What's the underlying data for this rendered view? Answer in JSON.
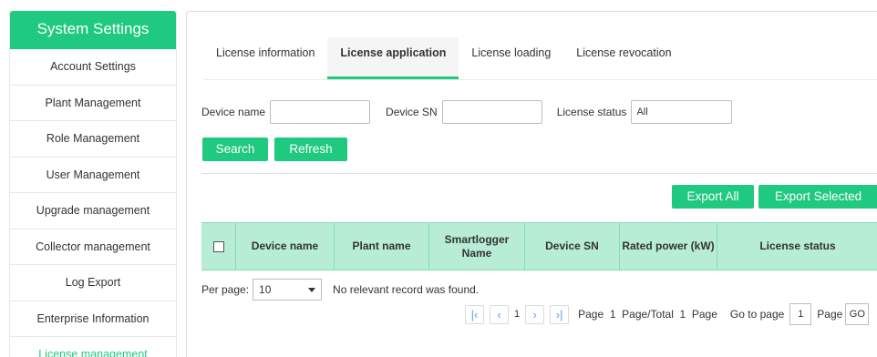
{
  "sidebar": {
    "title": "System Settings",
    "items": [
      {
        "label": "Account Settings"
      },
      {
        "label": "Plant Management"
      },
      {
        "label": "Role Management"
      },
      {
        "label": "User Management"
      },
      {
        "label": "Upgrade management"
      },
      {
        "label": "Collector management"
      },
      {
        "label": "Log Export"
      },
      {
        "label": "Enterprise Information"
      },
      {
        "label": "License management"
      }
    ]
  },
  "tabs": [
    {
      "label": "License information"
    },
    {
      "label": "License application"
    },
    {
      "label": "License loading"
    },
    {
      "label": "License revocation"
    }
  ],
  "filters": {
    "device_name_label": "Device name",
    "device_name_value": "",
    "device_sn_label": "Device SN",
    "device_sn_value": "",
    "license_status_label": "License status",
    "license_status_value": "All"
  },
  "buttons": {
    "search": "Search",
    "refresh": "Refresh",
    "export_all": "Export All",
    "export_selected": "Export Selected"
  },
  "table": {
    "columns": [
      "Device name",
      "Plant name",
      "Smartlogger Name",
      "Device SN",
      "Rated power (kW)",
      "License status"
    ]
  },
  "pagination": {
    "per_page_label": "Per page:",
    "per_page_value": "10",
    "empty_message": "No relevant record was found.",
    "current_page": "1",
    "page_info": "Page  1  Page/Total  1  Page",
    "goto_label": "Go to page",
    "goto_value": "1",
    "page_suffix": "Page",
    "go_button": "GO"
  },
  "colors": {
    "accent": "#1fc97f",
    "table_header": "#b7edd5",
    "pager_icon": "#5b9ff0"
  }
}
